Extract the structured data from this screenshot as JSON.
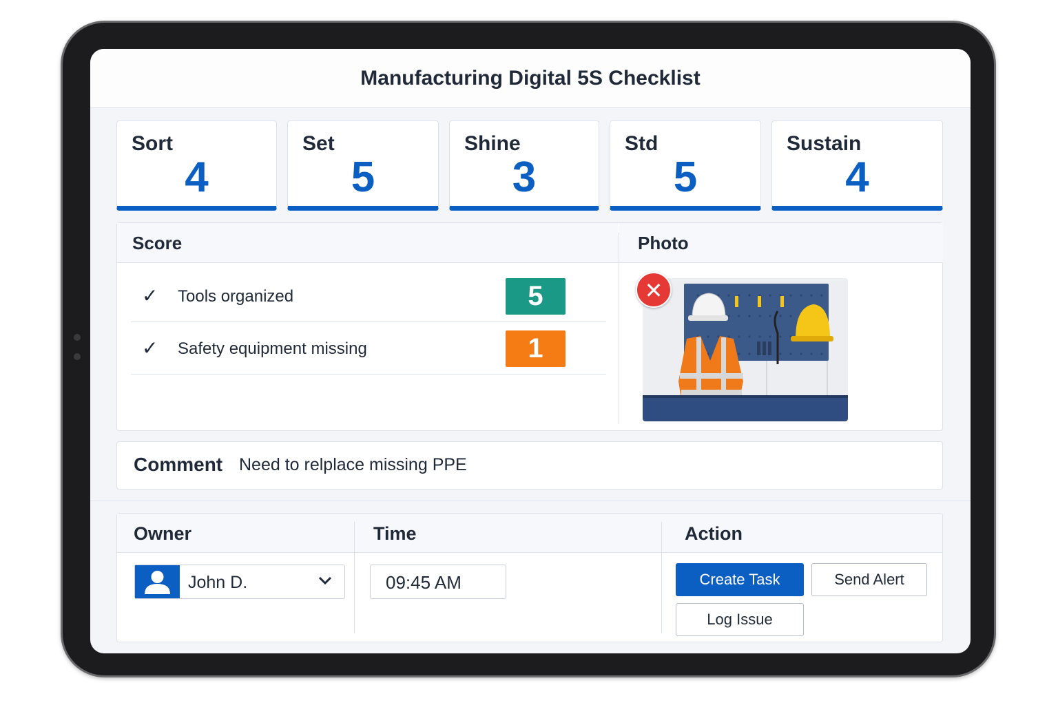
{
  "app": {
    "title": "Manufacturing Digital 5S Checklist"
  },
  "categories": [
    {
      "label": "Sort",
      "score": "4"
    },
    {
      "label": "Set",
      "score": "5"
    },
    {
      "label": "Shine",
      "score": "3"
    },
    {
      "label": "Std",
      "score": "5"
    },
    {
      "label": "Sustain",
      "score": "4"
    }
  ],
  "score_panel": {
    "heading": "Score",
    "items": [
      {
        "check": "✓",
        "text": "Tools organized",
        "score": "5",
        "color": "#1a9a86"
      },
      {
        "check": "✓",
        "text": "Safety equipment missing",
        "score": "1",
        "color": "#f57c14"
      }
    ]
  },
  "photo_panel": {
    "heading": "Photo",
    "remove_icon": "close-icon",
    "remove_glyph": "✕"
  },
  "comment": {
    "label": "Comment",
    "value": "Need to relplace missing PPE"
  },
  "owner": {
    "heading": "Owner",
    "selected": "John D.",
    "icon": "user-icon"
  },
  "time": {
    "heading": "Time",
    "value": "09:45 AM"
  },
  "action": {
    "heading": "Action",
    "create_task": "Create Task",
    "send_alert": "Send Alert",
    "log_issue": "Log Issue"
  },
  "colors": {
    "accent": "#0b5ec2",
    "good": "#1a9a86",
    "bad": "#f57c14",
    "remove": "#e53935"
  }
}
